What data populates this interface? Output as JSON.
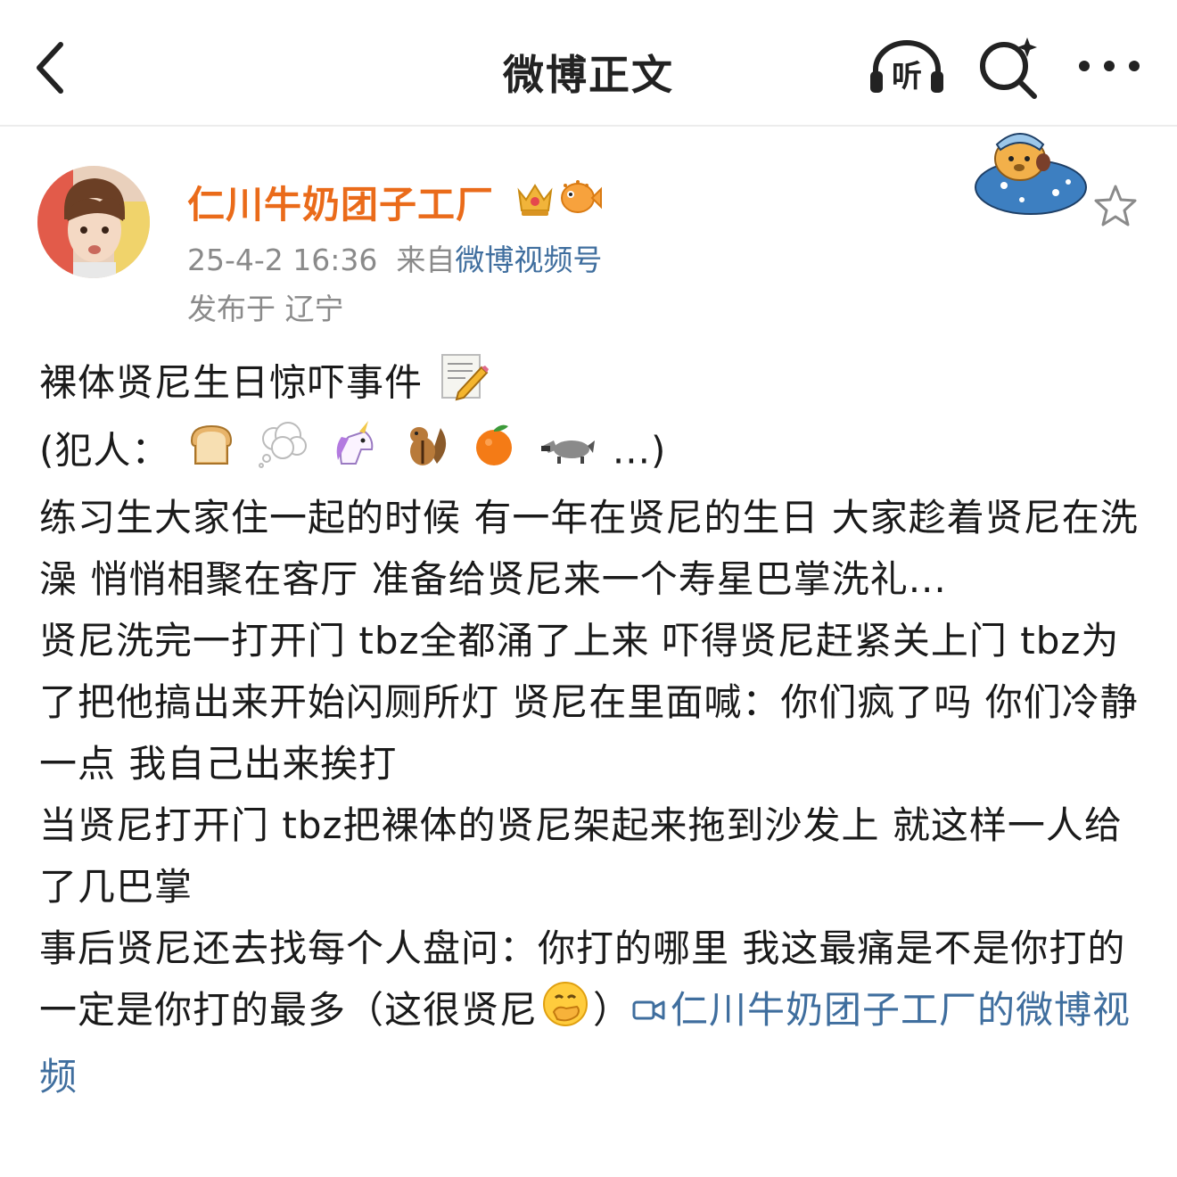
{
  "nav": {
    "title": "微博正文",
    "listen_label": "听",
    "icons": [
      "back-arrow-icon",
      "listen-headphone-icon",
      "search-sparkle-icon",
      "more-dots-icon"
    ]
  },
  "post": {
    "author": "仁川牛奶团子工厂",
    "badges": [
      "crown-badge-icon",
      "pufferfish-badge-icon"
    ],
    "timestamp": "25-4-2 16:36",
    "source_prefix": "来自",
    "source": "微博视频号",
    "location": "发布于 辽宁",
    "title_line": "裸体贤尼生日惊吓事件",
    "culprits_prefix": "(犯人：",
    "culprits_suffix": "...)",
    "culprit_emojis": [
      "bread",
      "thought-balloon",
      "unicorn",
      "chipmunk",
      "tangerine",
      "raccoon"
    ],
    "paragraph1": "练习生大家住一起的时候 有一年在贤尼的生日 大家趁着贤尼在洗澡 悄悄相聚在客厅 准备给贤尼来一个寿星巴掌洗礼...",
    "paragraph2": "贤尼洗完一打开门  tbz全都涌了上来  吓得贤尼赶紧关上门 tbz为了把他搞出来开始闪厕所灯 贤尼在里面喊：你们疯了吗  你们冷静一点 我自己出来挨打",
    "paragraph3": "当贤尼打开门  tbz把裸体的贤尼架起来拖到沙发上 就这样一人给了几巴掌",
    "paragraph4_start": "事后贤尼还去找每个人盘问：你打的哪里 我这最痛是不是你打的  一定是你打的最多（这很贤尼",
    "paragraph4_end": "）",
    "video_link": "仁川牛奶团子工厂的微博视频"
  },
  "colors": {
    "username": "#ea6b1a",
    "link": "#3f6e9e",
    "meta": "#8a8a8a"
  }
}
